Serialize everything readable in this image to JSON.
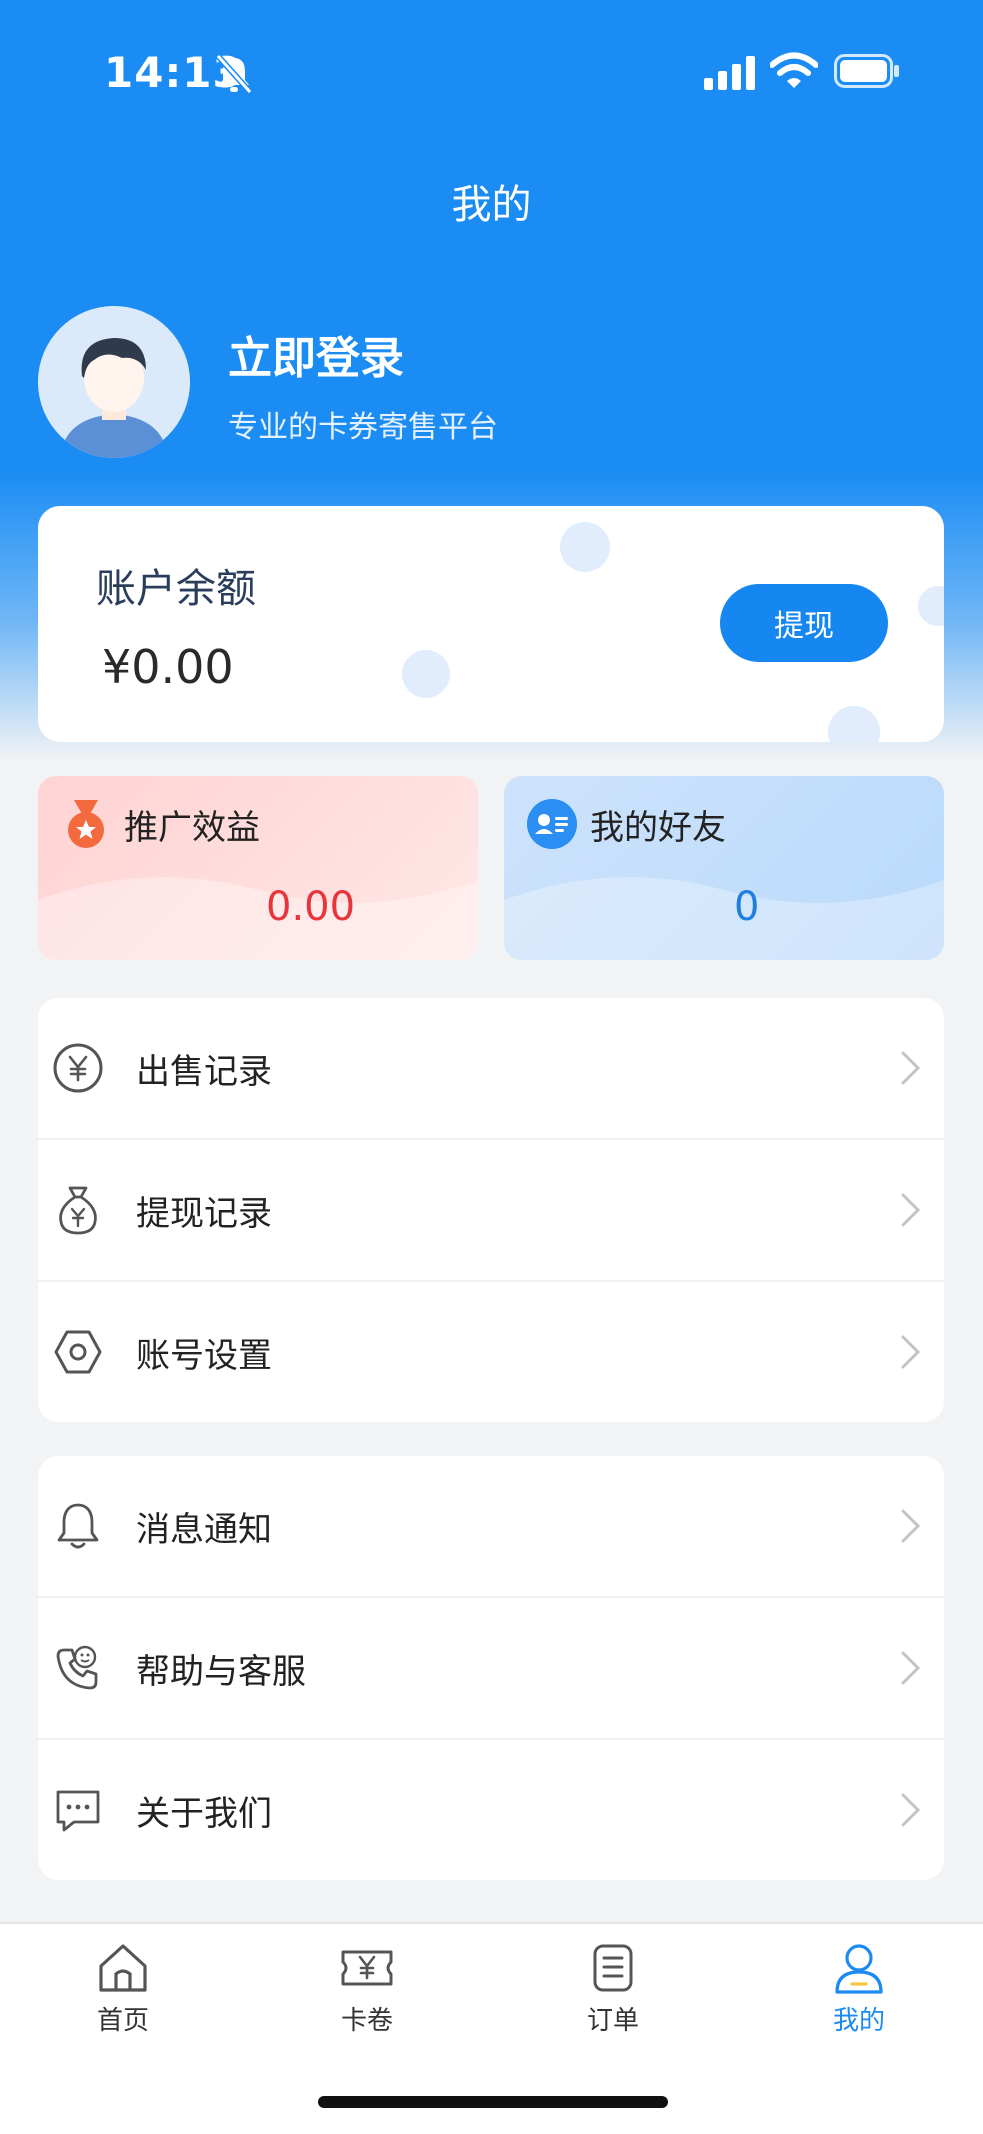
{
  "status_bar": {
    "time": "14:13"
  },
  "header": {
    "title": "我的"
  },
  "profile": {
    "login_label": "立即登录",
    "subtitle": "专业的卡券寄售平台"
  },
  "balance": {
    "label": "账户余额",
    "value": "¥0.00",
    "withdraw_label": "提现"
  },
  "stats": {
    "promotion": {
      "label": "推广效益",
      "value": "0.00",
      "color": "#e8343b"
    },
    "friends": {
      "label": "我的好友",
      "value": "0",
      "color": "#1f7fe0"
    }
  },
  "menu_group_1": [
    {
      "label": "出售记录",
      "icon": "yen-circle-icon"
    },
    {
      "label": "提现记录",
      "icon": "money-bag-icon"
    },
    {
      "label": "账号设置",
      "icon": "hexagon-settings-icon"
    }
  ],
  "menu_group_2": [
    {
      "label": "消息通知",
      "icon": "bell-icon"
    },
    {
      "label": "帮助与客服",
      "icon": "phone-support-icon"
    },
    {
      "label": "关于我们",
      "icon": "chat-bubble-icon"
    }
  ],
  "tabbar": {
    "items": [
      {
        "label": "首页",
        "icon": "home-icon"
      },
      {
        "label": "卡卷",
        "icon": "ticket-icon"
      },
      {
        "label": "订单",
        "icon": "order-list-icon"
      },
      {
        "label": "我的",
        "icon": "user-icon",
        "active": true
      }
    ]
  },
  "colors": {
    "primary": "#1a8cf4",
    "accent_red": "#e8343b",
    "background": "#f1f3f5"
  }
}
